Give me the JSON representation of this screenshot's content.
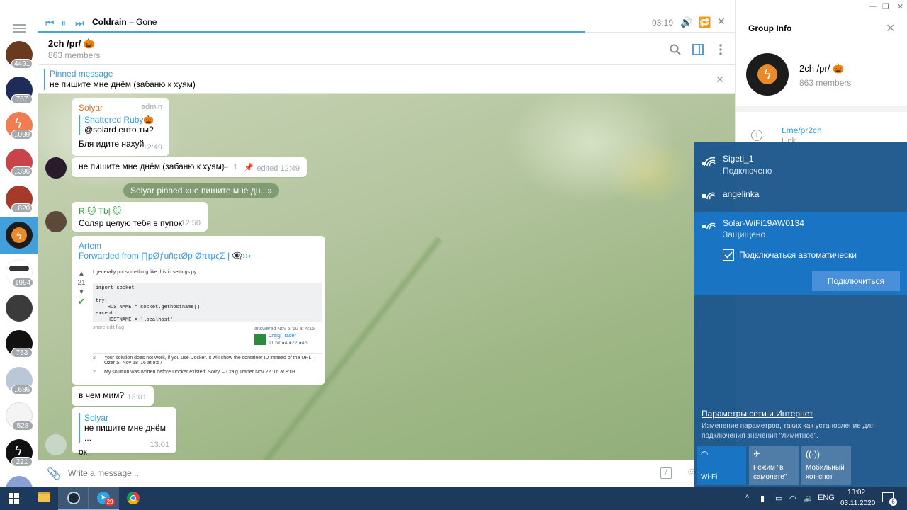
{
  "player": {
    "artist": "Coldrain",
    "separator": " – ",
    "track": "Gone",
    "time": "03:19",
    "progress": 0.785
  },
  "chat": {
    "title": "2ch /pr/ 🎃",
    "members": "863 members",
    "pinned_title": "Pinned message",
    "pinned_text": "не пишите мне днём (забаню к хуям)"
  },
  "chatlist": {
    "badges": [
      "4491",
      "767",
      "..099",
      "..396",
      "..820",
      "1994",
      "763",
      "..686",
      "528",
      "221"
    ]
  },
  "messages": {
    "m1": {
      "name": "Solyar",
      "role": "admin",
      "reply_name": "Shattered Ruby🎃",
      "reply_text": "@solard енто ты?",
      "text": "Бля идите нахуй",
      "time": "12:49"
    },
    "m2": {
      "text": "не пишите мне днём (забаню к хуям)",
      "replies": "1",
      "time": "edited 12:49"
    },
    "service": "Solyar pinned «не пишите мне дн...»",
    "m3": {
      "name": "R 🐱 Tb| 🐭",
      "text": "Соляр целую тебя в пупок",
      "time": "12:50"
    },
    "m4": {
      "name": "Artem",
      "forwarded": "Forwarded from ∏pØƒuñçτØp ØπτµςΣ | 👁‍🗨›››",
      "so_intro": "I generally put something like this in settings.py:",
      "so_votes": "21",
      "so_code": "import socket\n\ntry:\n    HOSTNAME = socket.gethostname()\nexcept:\n    HOSTNAME = 'localhost'",
      "so_share": "share  edit  flag",
      "so_answered": "answered Nov 5 '10 at 4:15",
      "so_user": "Craig Trader",
      "so_rep": "11.5k ●4 ●22 ●45",
      "so_c1_num": "2",
      "so_c1": "Your solution does not work, if you use Docker. It will show the container ID instead of the URL. – Özer S. Nov 18 '16 at 9:57",
      "so_c2_num": "2",
      "so_c2": "My solution was written before Docker existed. Sorry. – Craig Trader Nov 22 '16 at 8:03"
    },
    "m5": {
      "text": "в чем мим?",
      "time": "13:01"
    },
    "m6": {
      "reply_name": "Solyar",
      "reply_text": "не пишите мне днём ...",
      "text": "ок",
      "time": "13:01"
    }
  },
  "composer": {
    "placeholder": "Write a message..."
  },
  "info": {
    "title": "Group Info",
    "name": "2ch /pr/ 🎃",
    "members": "863 members",
    "link": "t.me/pr2ch",
    "link_label": "Link"
  },
  "wifi": {
    "networks": [
      {
        "ssid": "Sigeti_1",
        "status": "Подключено"
      },
      {
        "ssid": "angelinka",
        "status": ""
      },
      {
        "ssid": "Solar-WiFi19AW0134",
        "status": "Защищено"
      }
    ],
    "auto_connect": "Подключаться автоматически",
    "connect_button": "Подключиться",
    "settings_link": "Параметры сети и Интернет",
    "settings_desc": "Изменение параметров, таких как установление для подключения значения \"лимитное\".",
    "quick": [
      {
        "label": "Wi-Fi",
        "active": true
      },
      {
        "label": "Режим \"в самолете\"",
        "active": false
      },
      {
        "label": "Мобильный хот-спот",
        "active": false
      }
    ]
  },
  "taskbar": {
    "lang": "ENG",
    "time": "13:02",
    "date": "03.11.2020",
    "notif_count": "6",
    "telegram_badge": "29"
  },
  "colors": {
    "accent": "#4aa3df",
    "wifi_panel": "#1c568c",
    "wifi_selected": "#1a74c4",
    "taskbar": "#1d3a5c"
  }
}
